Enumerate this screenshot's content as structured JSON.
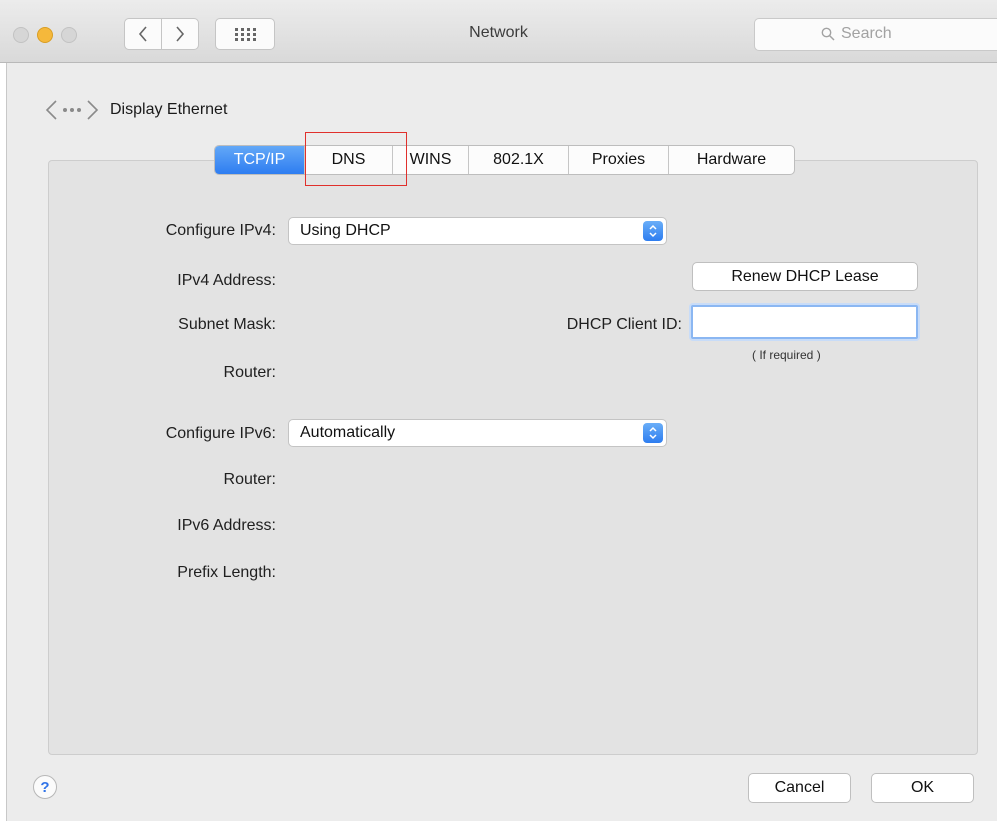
{
  "window": {
    "title": "Network"
  },
  "search": {
    "placeholder": "Search"
  },
  "header": {
    "interface_name": "Display Ethernet"
  },
  "tabs": [
    {
      "label": "TCP/IP",
      "active": true
    },
    {
      "label": "DNS",
      "active": false
    },
    {
      "label": "WINS",
      "active": false
    },
    {
      "label": "802.1X",
      "active": false
    },
    {
      "label": "Proxies",
      "active": false
    },
    {
      "label": "Hardware",
      "active": false
    }
  ],
  "ipv4": {
    "configure_label": "Configure IPv4:",
    "configure_value": "Using DHCP",
    "address_label": "IPv4 Address:",
    "subnet_label": "Subnet Mask:",
    "router_label": "Router:",
    "renew_button": "Renew DHCP Lease",
    "client_id_label": "DHCP Client ID:",
    "client_id_value": "",
    "client_id_hint": "( If required )"
  },
  "ipv6": {
    "configure_label": "Configure IPv6:",
    "configure_value": "Automatically",
    "router_label": "Router:",
    "address_label": "IPv6 Address:",
    "prefix_label": "Prefix Length:"
  },
  "footer": {
    "help_label": "?",
    "cancel_label": "Cancel",
    "ok_label": "OK"
  },
  "colors": {
    "accent": "#2e7df1",
    "highlight_box": "#e0302c",
    "minimize": "#f5b83b"
  },
  "icons": {
    "back": "chevron-left-icon",
    "forward": "chevron-right-icon",
    "grid": "grid-icon",
    "search": "magnifier-icon",
    "network": "ethernet-arrows-icon",
    "stepper": "up-down-chevron-icon"
  }
}
